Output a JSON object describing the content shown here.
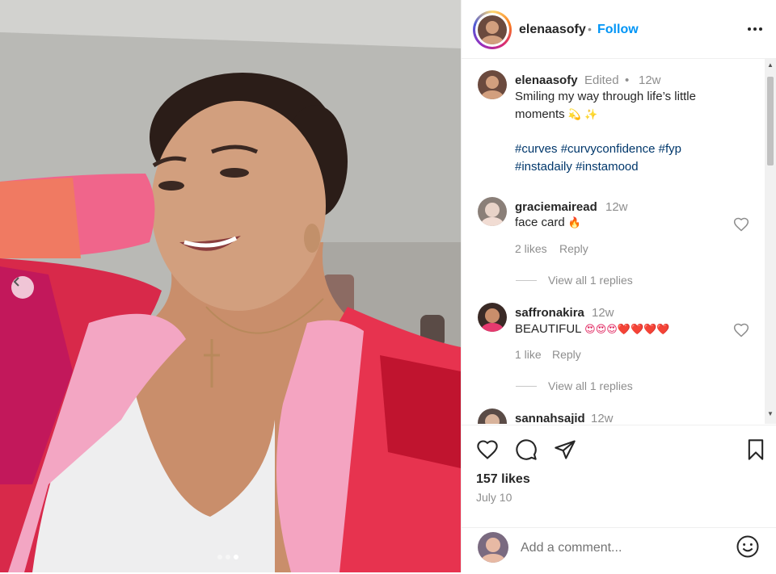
{
  "post": {
    "username": "elenaasofy",
    "follow_label": "Follow",
    "header_separator": "•",
    "caption": {
      "username": "elenaasofy",
      "edited": "Edited",
      "sep": "•",
      "time": "12w",
      "text_line1": "Smiling my way through life’s little",
      "text_line2": "moments",
      "emoji": "💫 ✨",
      "hashtags_line1": [
        "#curves",
        "#curvyconfidence",
        "#fyp"
      ],
      "hashtags_line2": [
        "#instadaily",
        "#instamood"
      ]
    },
    "likes": "157 likes",
    "date": "July 10",
    "add_comment_placeholder": "Add a comment..."
  },
  "comments": [
    {
      "username": "graciemairead",
      "time": "12w",
      "text": "face card",
      "emoji": "🔥",
      "likes": "2 likes",
      "reply_label": "Reply",
      "view_replies": "View all 1 replies"
    },
    {
      "username": "saffronakira",
      "time": "12w",
      "text": "BEAUTIFUL",
      "emoji": "😍😍😍❤️❤️❤️❤️",
      "likes": "1 like",
      "reply_label": "Reply",
      "view_replies": "View all 1 replies"
    },
    {
      "username": "sannahsajid",
      "time": "12w"
    }
  ],
  "icons": {
    "like": "heart-icon",
    "comment": "comment-bubble-icon",
    "share": "paper-plane-icon",
    "save": "bookmark-icon",
    "more": "more-options-icon",
    "emoji": "smiley-icon",
    "carousel_prev": "chevron-left-icon"
  },
  "colors": {
    "follow": "#0095f6",
    "hashtag": "#00376b",
    "muted": "#8e8e8e",
    "text": "#262626",
    "fire": "#f4900c",
    "heart_red": "#e0245e"
  },
  "carousel": {
    "count": 3,
    "active_index": 2
  }
}
